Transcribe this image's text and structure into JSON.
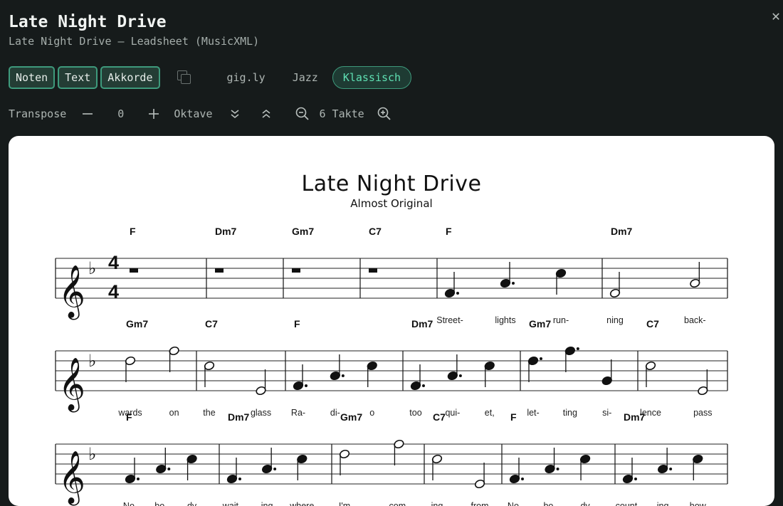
{
  "header": {
    "title": "Late Night Drive",
    "subtitle": "Late Night Drive — Leadsheet (MusicXML)",
    "close_icon": "close-icon"
  },
  "toolbar": {
    "view_buttons": [
      "Noten",
      "Text",
      "Akkorde"
    ],
    "copy_icon": "copy-icon",
    "styles": [
      "gig.ly",
      "Jazz"
    ],
    "active_style": "Klassisch"
  },
  "controls": {
    "transpose_label": "Transpose",
    "transpose_value": "0",
    "octave_label": "Oktave",
    "bars_label": "6 Takte"
  },
  "score": {
    "title": "Late Night Drive",
    "subtitle": "Almost Original",
    "key": "F major (1 flat)",
    "time_signature": "4/4",
    "systems": [
      {
        "measures": [
          {
            "chord": "F",
            "notes": [
              {
                "type": "rest-whole"
              }
            ],
            "lyrics": []
          },
          {
            "chord": "Dm7",
            "notes": [
              {
                "type": "rest-whole"
              }
            ],
            "lyrics": []
          },
          {
            "chord": "Gm7",
            "notes": [
              {
                "type": "rest-whole"
              }
            ],
            "lyrics": []
          },
          {
            "chord": "C7",
            "notes": [
              {
                "type": "rest-whole"
              }
            ],
            "lyrics": []
          },
          {
            "chord": "F",
            "notes": [
              {
                "pitch": "F4",
                "type": "dotted-quarter"
              },
              {
                "pitch": "A4",
                "type": "dotted-quarter"
              },
              {
                "pitch": "C5",
                "type": "quarter"
              }
            ],
            "lyrics": [
              "Street-",
              "lights",
              "run-"
            ]
          },
          {
            "chord": "Dm7",
            "notes": [
              {
                "pitch": "F4",
                "type": "half"
              },
              {
                "pitch": "A4",
                "type": "half"
              }
            ],
            "lyrics": [
              "ning",
              "back-"
            ]
          }
        ]
      },
      {
        "measures": [
          {
            "chord": "Gm7",
            "notes": [
              {
                "pitch": "D5",
                "type": "half"
              },
              {
                "pitch": "F5",
                "type": "half"
              }
            ],
            "lyrics": [
              "wards",
              "on"
            ]
          },
          {
            "chord": "C7",
            "notes": [
              {
                "pitch": "C5",
                "type": "half"
              },
              {
                "pitch": "E4",
                "type": "half"
              }
            ],
            "lyrics": [
              "the",
              "glass"
            ]
          },
          {
            "chord": "F",
            "notes": [
              {
                "pitch": "F4",
                "type": "dotted-quarter"
              },
              {
                "pitch": "A4",
                "type": "dotted-quarter"
              },
              {
                "pitch": "C5",
                "type": "quarter"
              }
            ],
            "lyrics": [
              "Ra-",
              "di-",
              "o"
            ]
          },
          {
            "chord": "Dm7",
            "notes": [
              {
                "pitch": "F4",
                "type": "dotted-quarter"
              },
              {
                "pitch": "A4",
                "type": "dotted-quarter"
              },
              {
                "pitch": "C5",
                "type": "quarter"
              }
            ],
            "lyrics": [
              "too",
              "qui-",
              "et,"
            ]
          },
          {
            "chord": "Gm7",
            "notes": [
              {
                "pitch": "D5",
                "type": "dotted-quarter"
              },
              {
                "pitch": "F5",
                "type": "dotted-quarter"
              },
              {
                "pitch": "G4",
                "type": "quarter"
              }
            ],
            "lyrics": [
              "let-",
              "ting",
              "si-"
            ]
          },
          {
            "chord": "C7",
            "notes": [
              {
                "pitch": "C5",
                "type": "half"
              },
              {
                "pitch": "E4",
                "type": "half"
              }
            ],
            "lyrics": [
              "lence",
              "pass"
            ]
          }
        ]
      },
      {
        "measures": [
          {
            "chord": "F",
            "notes": [
              {
                "pitch": "F4",
                "type": "dotted-quarter"
              },
              {
                "pitch": "A4",
                "type": "dotted-quarter"
              },
              {
                "pitch": "C5",
                "type": "quarter"
              }
            ],
            "lyrics": [
              "No-",
              "bo-",
              "dy"
            ]
          },
          {
            "chord": "Dm7",
            "notes": [
              {
                "pitch": "F4",
                "type": "dotted-quarter"
              },
              {
                "pitch": "A4",
                "type": "dotted-quarter"
              },
              {
                "pitch": "C5",
                "type": "quarter"
              }
            ],
            "lyrics": [
              "wait-",
              "ing",
              "where"
            ]
          },
          {
            "chord": "Gm7",
            "notes": [
              {
                "pitch": "D5",
                "type": "half"
              },
              {
                "pitch": "F5",
                "type": "half"
              }
            ],
            "lyrics": [
              "I'm",
              "com-"
            ]
          },
          {
            "chord": "C7",
            "notes": [
              {
                "pitch": "C5",
                "type": "half"
              },
              {
                "pitch": "E4",
                "type": "half"
              }
            ],
            "lyrics": [
              "ing",
              "from"
            ]
          },
          {
            "chord": "F",
            "notes": [
              {
                "pitch": "F4",
                "type": "dotted-quarter"
              },
              {
                "pitch": "A4",
                "type": "dotted-quarter"
              },
              {
                "pitch": "C5",
                "type": "quarter"
              }
            ],
            "lyrics": [
              "No-",
              "bo-",
              "dy"
            ]
          },
          {
            "chord": "Dm7",
            "notes": [
              {
                "pitch": "F4",
                "type": "dotted-quarter"
              },
              {
                "pitch": "A4",
                "type": "dotted-quarter"
              },
              {
                "pitch": "C5",
                "type": "quarter"
              }
            ],
            "lyrics": [
              "count-",
              "ing",
              "how"
            ]
          }
        ]
      }
    ]
  }
}
